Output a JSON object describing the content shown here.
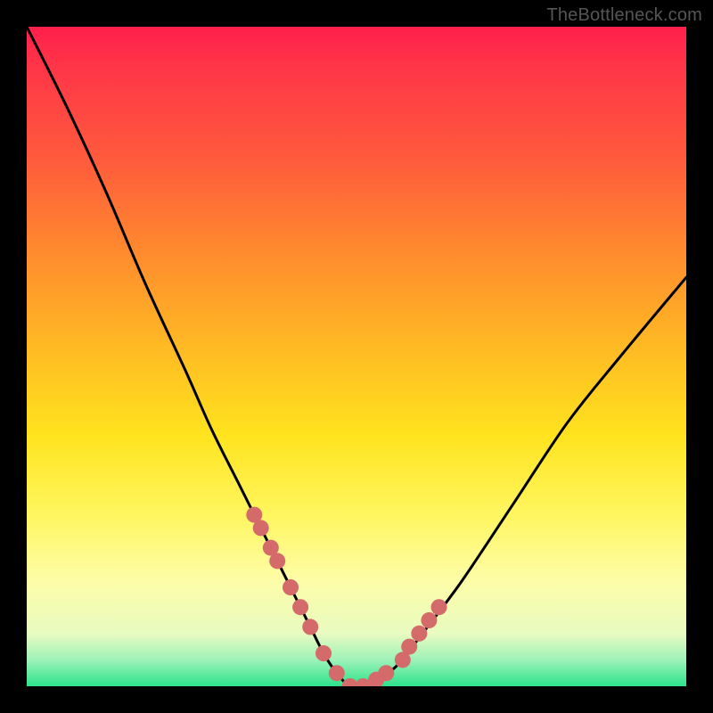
{
  "watermark": "TheBottleneck.com",
  "chart_data": {
    "type": "line",
    "title": "",
    "xlabel": "",
    "ylabel": "",
    "xlim": [
      0,
      100
    ],
    "ylim": [
      0,
      100
    ],
    "grid": false,
    "legend": false,
    "series": [
      {
        "name": "bottleneck-curve",
        "color": "#000000",
        "x": [
          0,
          6,
          12,
          18,
          24,
          28,
          32,
          35,
          37,
          39,
          41,
          43,
          45,
          47,
          49,
          51,
          53,
          56,
          60,
          66,
          74,
          82,
          90,
          100
        ],
        "values": [
          100,
          88,
          75,
          61,
          48,
          39,
          31,
          25,
          21,
          17,
          13,
          9,
          5,
          2,
          0,
          0,
          1,
          3,
          8,
          16,
          28,
          40,
          50,
          62
        ]
      }
    ],
    "markers": {
      "name": "highlighted-points",
      "color": "#d46a6a",
      "radius_px": 9,
      "x": [
        34.5,
        35.5,
        37.0,
        38.0,
        40.0,
        41.5,
        43.0,
        45.0,
        47.0,
        49.0,
        51.0,
        53.0,
        54.5,
        57.0,
        58.0,
        59.5,
        61.0,
        62.5
      ],
      "values": [
        26.0,
        24.0,
        21.0,
        19.0,
        15.0,
        12.0,
        9.0,
        5.0,
        2.0,
        0.0,
        0.0,
        1.0,
        2.0,
        4.0,
        6.0,
        8.0,
        10.0,
        12.0
      ]
    }
  }
}
